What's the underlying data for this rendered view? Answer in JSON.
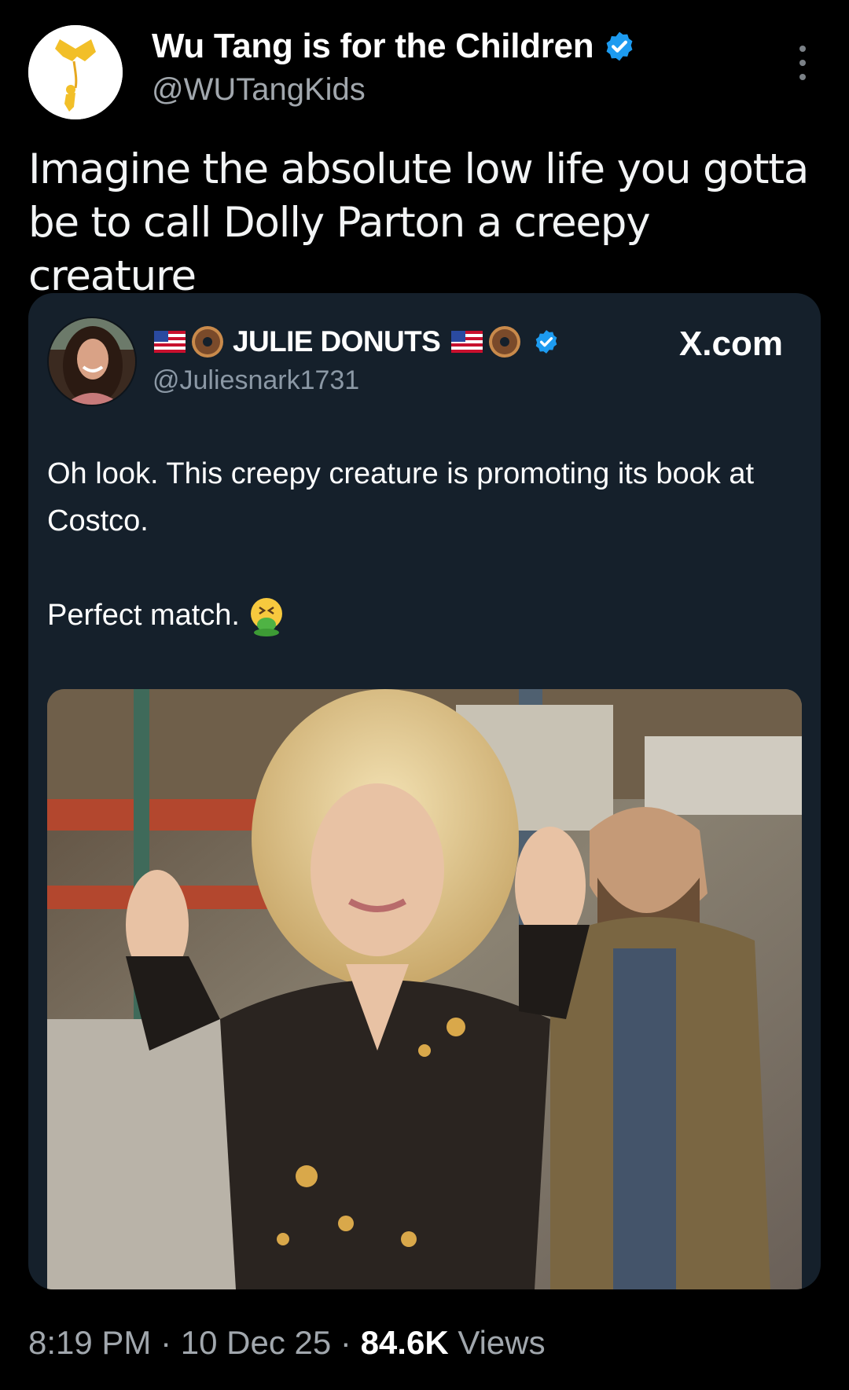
{
  "author": {
    "display_name": "Wu Tang is for the Children",
    "handle": "@WUTangKids",
    "avatar": "wu-tang-logo-avatar",
    "verified": true
  },
  "tweet": {
    "text": "Imagine the absolute low life you gotta be to call Dolly Parton a creepy creature"
  },
  "quoted": {
    "display_name": "JULIE DONUTS",
    "handle": "@Juliesnark1731",
    "verified": true,
    "source": "X.com",
    "text_line1": "Oh look. This creepy creature is promoting its book at Costco.",
    "text_line2": "Perfect match.",
    "emoji": "vomiting-face-emoji",
    "name_decorations": [
      "us-flag-icon",
      "donut-icon"
    ]
  },
  "meta": {
    "time": "8:19 PM",
    "separator": "·",
    "date": "10 Dec 25",
    "views_count": "84.6K",
    "views_label": "Views"
  },
  "colors": {
    "background": "#000000",
    "card": "#15202b",
    "verified_blue": "#1d9bf0",
    "secondary_text": "#a1a7ad"
  }
}
